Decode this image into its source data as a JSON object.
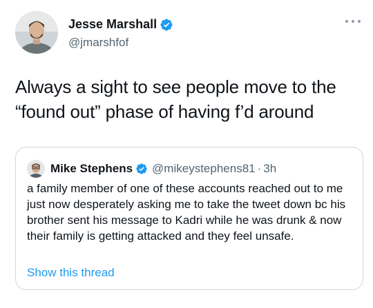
{
  "tweet": {
    "author_name": "Jesse Marshall",
    "author_handle": "@jmarshfof",
    "text_line1": "Always a sight to see people move to the",
    "text_line2": "“found out” phase of having f’d around"
  },
  "quoted_tweet": {
    "author_name": "Mike Stephens",
    "author_handle": "@mikeystephens81",
    "separator": "·",
    "time": "3h",
    "text": "a family member of one of these accounts reached out to me just now desperately asking me to take the tweet down bc his brother sent his message to Kadri while he was drunk & now their family is getting attacked and they feel unsafe.",
    "show_thread_label": "Show this thread"
  },
  "colors": {
    "verified_blue": "#1d9bf0",
    "link_blue": "#1d9bf0",
    "secondary_text": "#536471",
    "border": "#cfd9de"
  },
  "icons": {
    "verified": "verified-badge-icon",
    "more": "more-horizontal-icon"
  }
}
